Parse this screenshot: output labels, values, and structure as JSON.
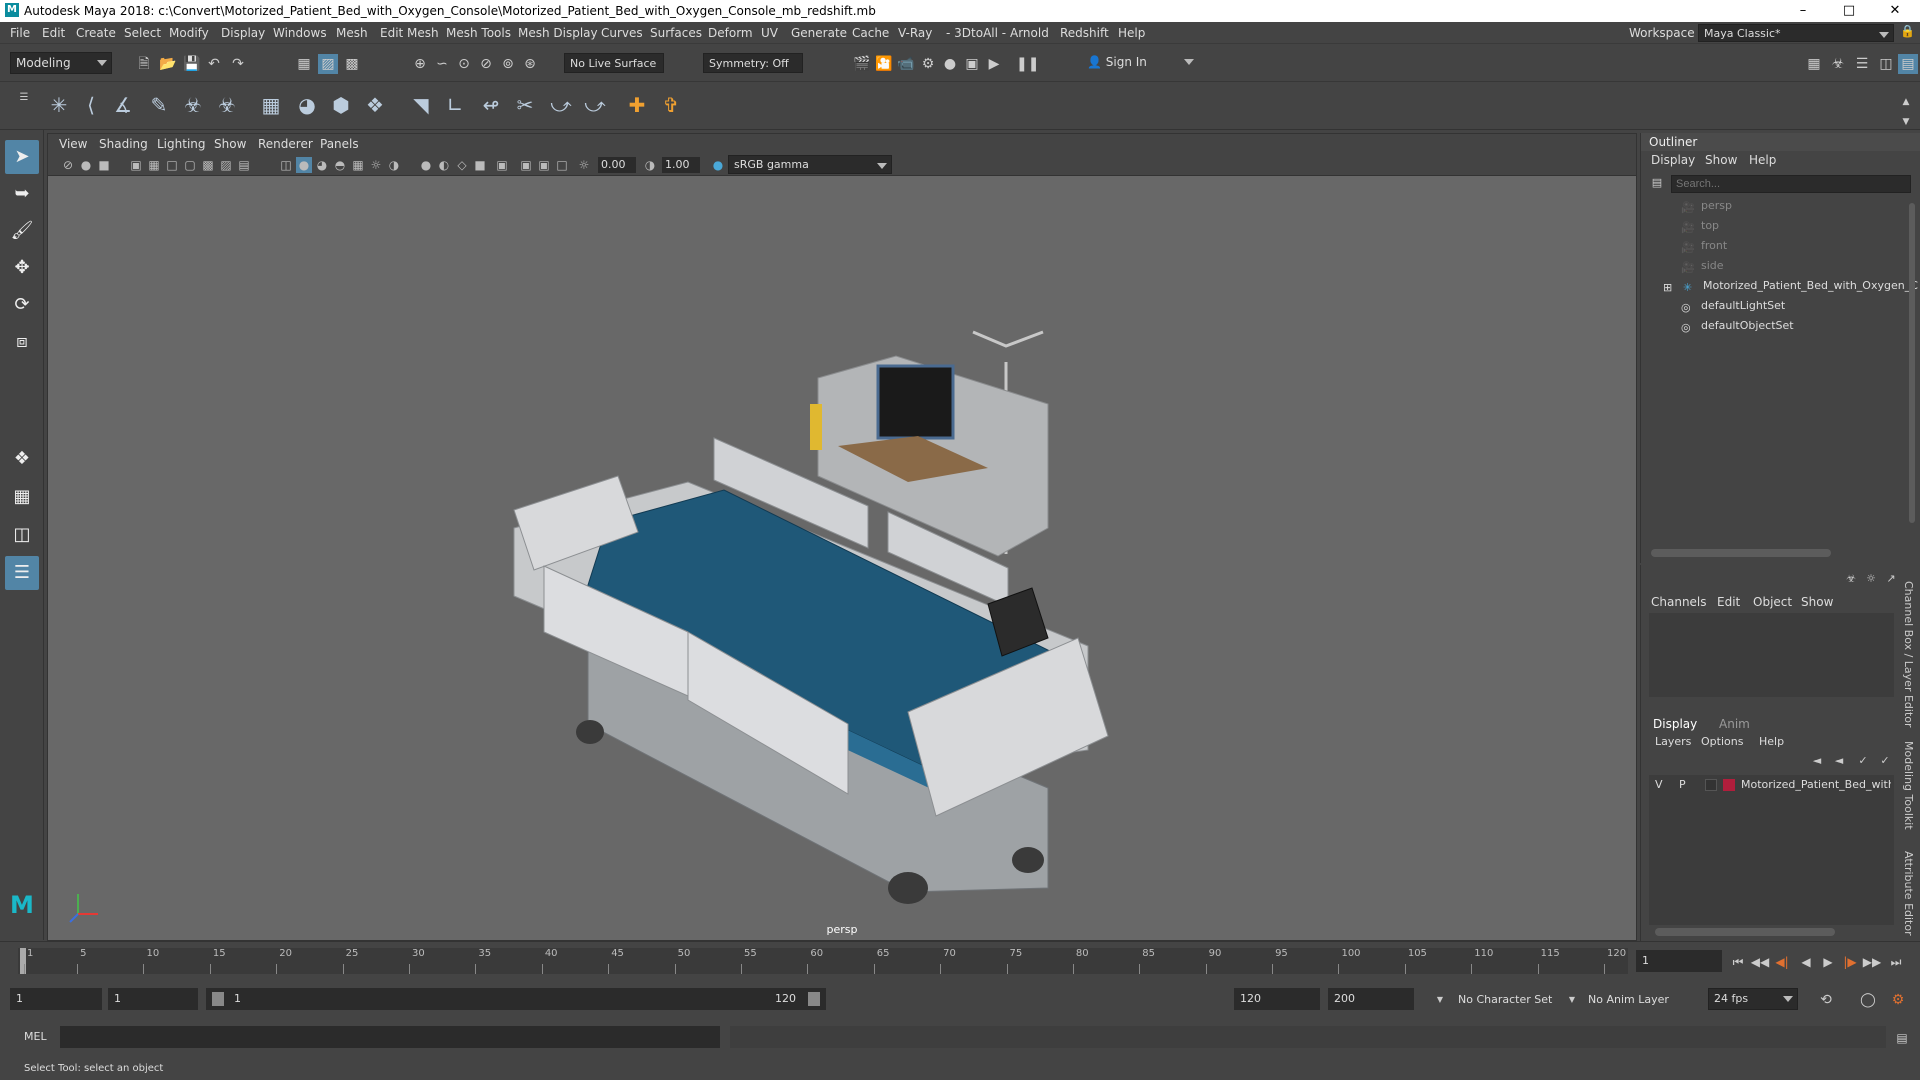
{
  "window": {
    "title": "Autodesk Maya 2018: c:\\Convert\\Motorized_Patient_Bed_with_Oxygen_Console\\Motorized_Patient_Bed_with_Oxygen_Console_mb_redshift.mb",
    "logo": "M"
  },
  "menus": [
    "File",
    "Edit",
    "Create",
    "Select",
    "Modify",
    "Display",
    "Windows",
    "Mesh",
    "Edit Mesh",
    "Mesh Tools",
    "Mesh Display",
    "Curves",
    "Surfaces",
    "Deform",
    "UV",
    "Generate",
    "Cache",
    "V-Ray",
    "3DtoAll",
    "Arnold",
    "Redshift",
    "Help"
  ],
  "workspace": {
    "label": "Workspace :",
    "value": "Maya Classic*"
  },
  "status": {
    "mode": "Modeling",
    "live_surface": "No Live Surface",
    "symmetry": "Symmetry: Off",
    "sign_in": "Sign In"
  },
  "viewport": {
    "menus": [
      "View",
      "Shading",
      "Lighting",
      "Show",
      "Renderer",
      "Panels"
    ],
    "exposure": "0.00",
    "gamma": "1.00",
    "color_space": "sRGB gamma",
    "camera": "persp"
  },
  "outliner": {
    "title": "Outliner",
    "menus": [
      "Display",
      "Show",
      "Help"
    ],
    "search_placeholder": "Search...",
    "items": [
      "persp",
      "top",
      "front",
      "side",
      "Motorized_Patient_Bed_with_Oxygen_C",
      "defaultLightSet",
      "defaultObjectSet"
    ]
  },
  "channelbox": {
    "menus": [
      "Channels",
      "Edit",
      "Object",
      "Show"
    ],
    "tabs": [
      "Display",
      "Anim"
    ],
    "layer_menus": [
      "Layers",
      "Options",
      "Help"
    ],
    "layer": {
      "v": "V",
      "p": "P",
      "name": "Motorized_Patient_Bed_with_O",
      "color": "#b01e3c"
    }
  },
  "side_tabs": [
    "Channel Box / Layer Editor",
    "Modeling Toolkit",
    "Attribute Editor"
  ],
  "timeline": {
    "ticks": [
      "1",
      "5",
      "10",
      "15",
      "20",
      "25",
      "30",
      "35",
      "40",
      "45",
      "50",
      "55",
      "60",
      "65",
      "70",
      "75",
      "80",
      "85",
      "90",
      "95",
      "100",
      "105",
      "110",
      "115",
      "120"
    ],
    "current_frame": "1"
  },
  "range": {
    "start": "1",
    "playback_start": "1",
    "slider_start": "1",
    "slider_end": "120",
    "playback_end": "120",
    "end": "200",
    "character_set": "No Character Set",
    "anim_layer": "No Anim Layer",
    "fps": "24 fps"
  },
  "mel": {
    "label": "MEL"
  },
  "help_line": "Select Tool: select an object"
}
